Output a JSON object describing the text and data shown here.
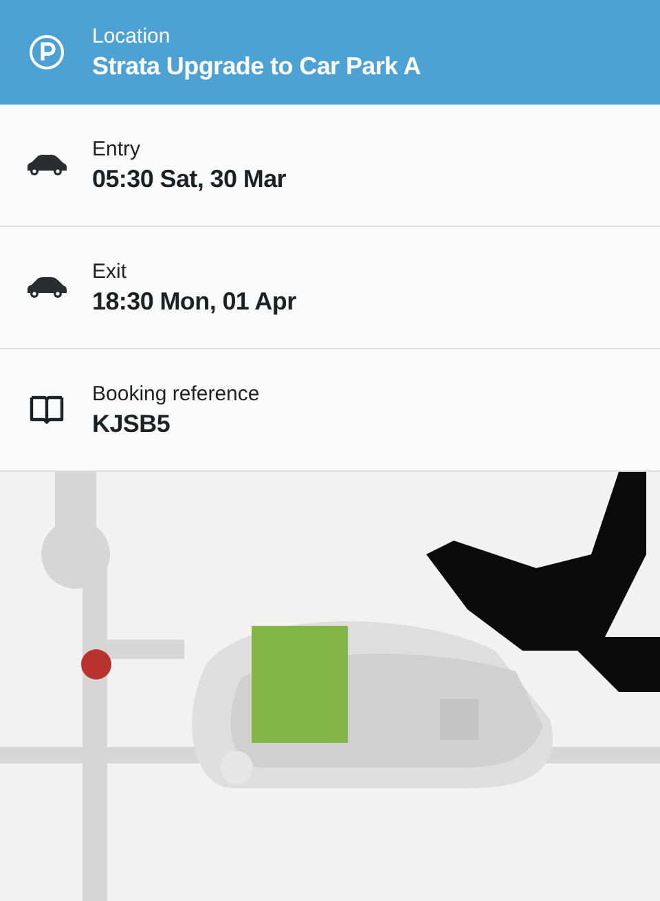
{
  "details": [
    {
      "kind": "parking",
      "selected": true,
      "label": "Location",
      "value": "Strata Upgrade to Car Park A"
    },
    {
      "kind": "car",
      "selected": false,
      "label": "Entry",
      "value": "05:30 Sat, 30 Mar"
    },
    {
      "kind": "car",
      "selected": false,
      "label": "Exit",
      "value": "18:30 Mon, 01 Apr"
    },
    {
      "kind": "book",
      "selected": false,
      "label": "Booking reference",
      "value": "KJSB5"
    }
  ]
}
